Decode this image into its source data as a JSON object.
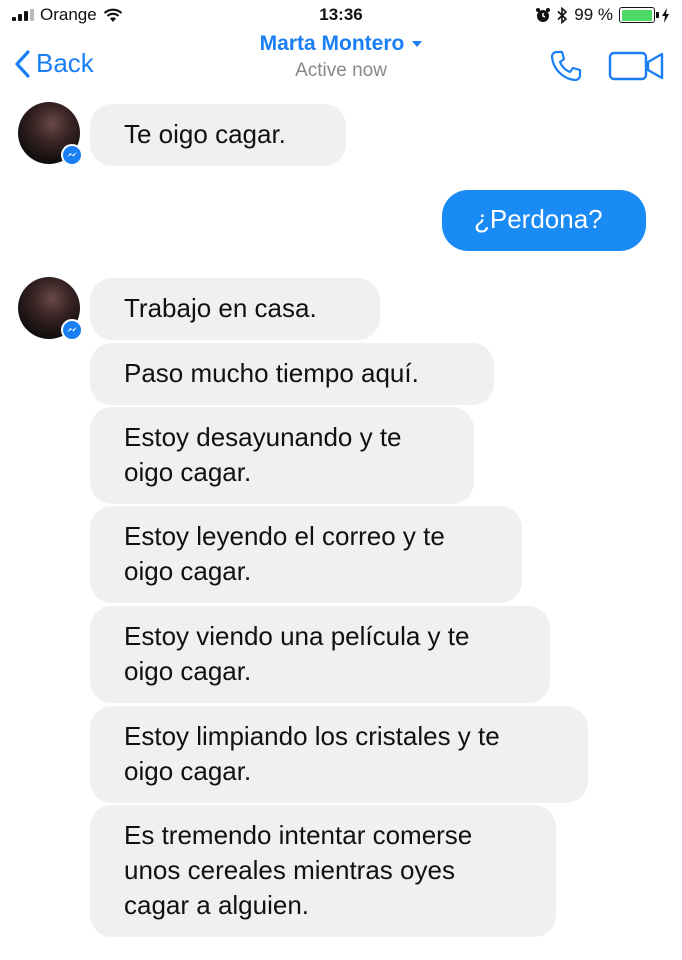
{
  "status_bar": {
    "carrier": "Orange",
    "time": "13:36",
    "battery": "99 %",
    "battery_level": 0.99
  },
  "header": {
    "back_label": "Back",
    "contact_name": "Marta Montero",
    "contact_status": "Active now"
  },
  "messages": [
    {
      "from": "contact",
      "text": "Te oigo cagar."
    },
    {
      "from": "me",
      "text": "¿Perdona?"
    },
    {
      "from": "contact",
      "text": "Trabajo en casa."
    },
    {
      "from": "contact",
      "text": "Paso mucho tiempo aquí."
    },
    {
      "from": "contact",
      "text": "Estoy desayunando y te oigo cagar."
    },
    {
      "from": "contact",
      "text": "Estoy leyendo el correo y te oigo cagar."
    },
    {
      "from": "contact",
      "text": "Estoy viendo una película y te oigo cagar."
    },
    {
      "from": "contact",
      "text": "Estoy limpiando los cristales y te oigo cagar."
    },
    {
      "from": "contact",
      "text": "Es tremendo intentar comerse unos cereales mientras oyes cagar a alguien."
    }
  ],
  "colors": {
    "accent": "#1a7ef5",
    "outgoing_bubble": "#1a8af5",
    "incoming_bubble": "#f0f0f2"
  },
  "icons": [
    "signal-icon",
    "wifi-icon",
    "alarm-icon",
    "bluetooth-icon",
    "battery-icon",
    "charging-icon",
    "chevron-left-icon",
    "phone-icon",
    "video-camera-icon",
    "messenger-icon"
  ]
}
